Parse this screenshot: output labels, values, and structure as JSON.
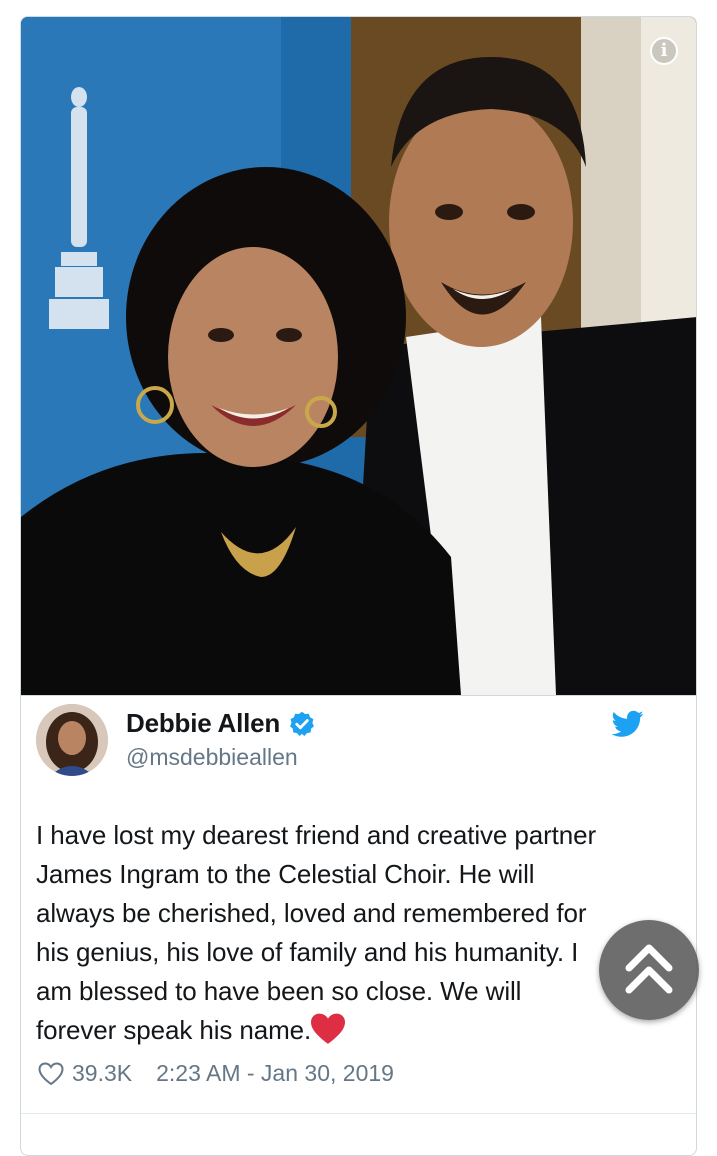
{
  "tweet": {
    "author": {
      "display_name": "Debbie Allen",
      "handle": "@msdebbieallen",
      "verified": true
    },
    "text_lines": [
      "I have lost my dearest friend and creative partner",
      "James Ingram to the Celestial Choir. He will",
      "always be cherished, loved and remembered for",
      "his genius, his love of family and his humanity. I",
      "am blessed to have been so close. We will",
      "forever speak his name."
    ],
    "emoji": "red-heart",
    "likes": "39.3K",
    "timestamp": "2:23 AM - Jan 30, 2019"
  },
  "icons": {
    "info": "info-icon",
    "verified": "verified-badge-icon",
    "brand": "twitter-bird-icon",
    "like": "heart-outline-icon",
    "scroll_top": "double-chevron-up-icon"
  },
  "colors": {
    "brand_blue": "#1da1f2",
    "text": "#14171a",
    "secondary_text": "#657786",
    "heart_red": "#e0245e"
  }
}
